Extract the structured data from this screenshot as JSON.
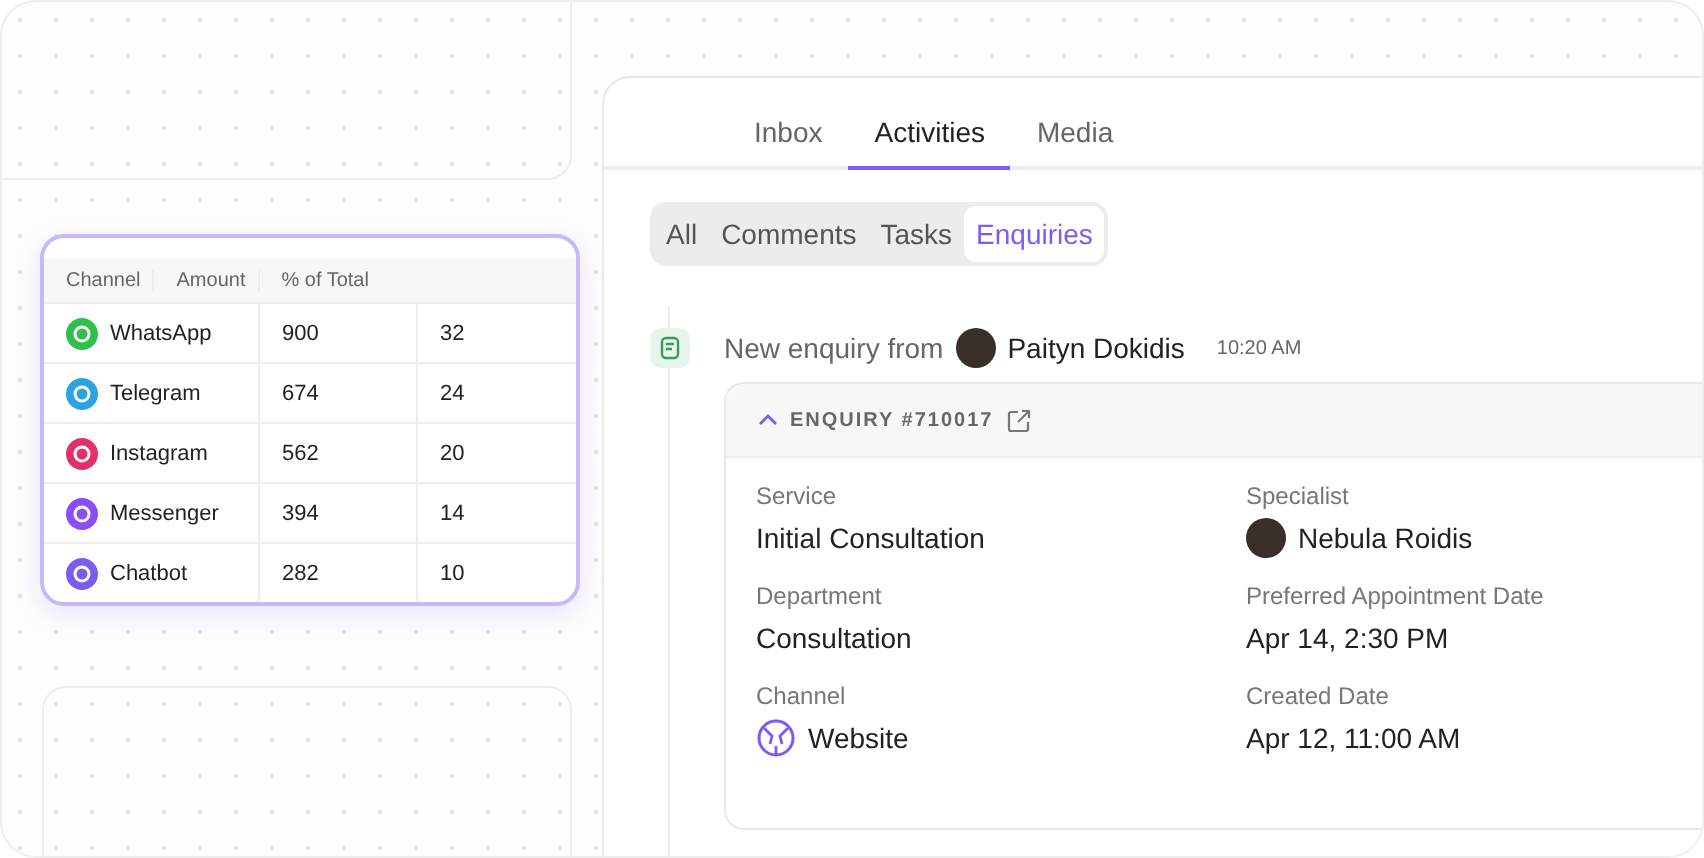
{
  "channel_table": {
    "columns": [
      "Channel",
      "Amount",
      "% of Total"
    ],
    "rows": [
      {
        "channel": "WhatsApp",
        "amount": "900",
        "percent": "32",
        "color": "#2fbf4a"
      },
      {
        "channel": "Telegram",
        "amount": "674",
        "percent": "24",
        "color": "#2aa3e0"
      },
      {
        "channel": "Instagram",
        "amount": "562",
        "percent": "20",
        "color": "#e1306c"
      },
      {
        "channel": "Messenger",
        "amount": "394",
        "percent": "14",
        "color": "#8a4dfc"
      },
      {
        "channel": "Chatbot",
        "amount": "282",
        "percent": "10",
        "color": "#7b5cf0"
      }
    ]
  },
  "tabs": [
    {
      "label": "Inbox",
      "selected": false
    },
    {
      "label": "Activities",
      "selected": true
    },
    {
      "label": "Media",
      "selected": false
    }
  ],
  "filters": [
    {
      "label": "All",
      "selected": false
    },
    {
      "label": "Comments",
      "selected": false
    },
    {
      "label": "Tasks",
      "selected": false
    },
    {
      "label": "Enquiries",
      "selected": true
    }
  ],
  "activity": {
    "prefix": "New enquiry from",
    "person": "Paityn Dokidis",
    "time": "10:20 AM",
    "enquiry": {
      "title": "ENQUIRY #710017",
      "expanded": true,
      "fields": [
        {
          "label": "Service",
          "value": "Initial Consultation"
        },
        {
          "label": "Specialist",
          "value": "Nebula Roidis",
          "kind": "person"
        },
        {
          "label": "Department",
          "value": "Consultation"
        },
        {
          "label": "Preferred Appointment Date",
          "value": "Apr 14, 2:30 PM"
        },
        {
          "label": "Channel",
          "value": "Website",
          "kind": "web"
        },
        {
          "label": "Created Date",
          "value": "Apr 12, 11:00 AM"
        }
      ]
    }
  }
}
